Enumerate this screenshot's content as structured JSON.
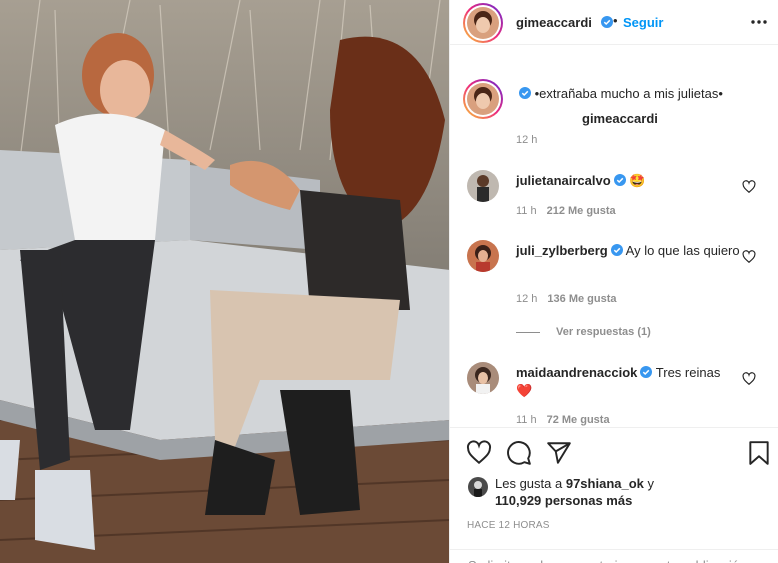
{
  "post": {
    "username": "gimeaccardi",
    "dot": "•",
    "follow_label": "Seguir",
    "caption": "•extrañaba mucho a mis julietas•",
    "caption_time": "12 h"
  },
  "comments": [
    {
      "username": "julietanaircalvo",
      "text": "🤩",
      "time": "11 h",
      "likes": "212 Me gusta"
    },
    {
      "username": "juli_zylberberg",
      "text": "Ay lo que las quiero",
      "time": "12 h",
      "likes": "136 Me gusta",
      "replies": "Ver respuestas (1)"
    },
    {
      "username": "maidaandrenacciok",
      "text": "Tres reinas",
      "emoji": "❤️",
      "time": "11 h",
      "likes": "72 Me gusta"
    }
  ],
  "actions": {
    "icons": [
      "heart-icon",
      "comment-icon",
      "share-icon",
      "bookmark-icon"
    ],
    "liked_prefix": "Les gusta a",
    "liked_user": "97shiana_ok",
    "liked_and": "y",
    "liked_count": "110,929 personas más",
    "time_ago": "HACE 12 HORAS",
    "comments_limited": "Se limitaron los comentarios en esta publicación."
  },
  "colors": {
    "accent": "#0095f6",
    "verified": "#3897f0",
    "muted": "#8e8e8e",
    "text": "#262626"
  }
}
